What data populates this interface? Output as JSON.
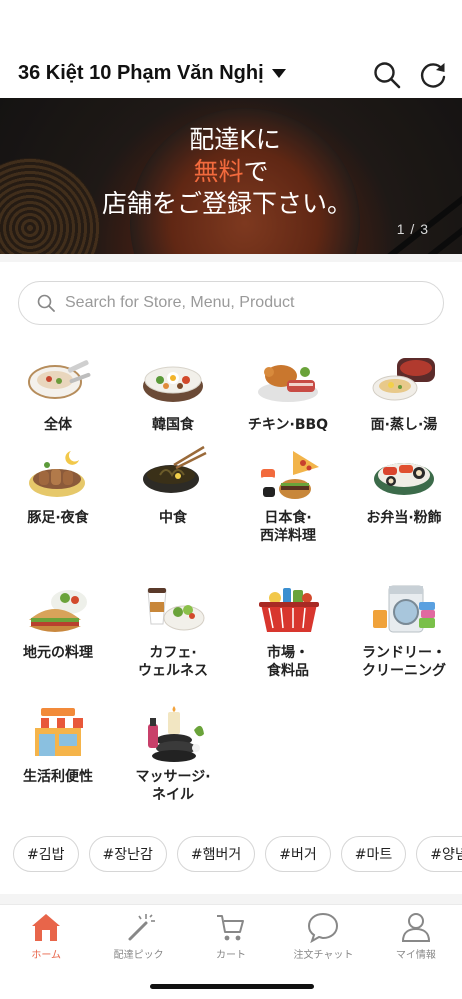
{
  "header": {
    "address": "36 Kiệt 10 Phạm Văn Nghị",
    "search_icon": "search-icon",
    "refresh_icon": "refresh-icon"
  },
  "banner": {
    "line1": "配達Kに",
    "line2_highlight": "無料",
    "line2_rest": "で",
    "line3": "店舗をご登録下さい。",
    "pager": "1 / 3",
    "highlight_color": "#f26a3d"
  },
  "search": {
    "placeholder": "Search for Store, Menu, Product"
  },
  "categories": [
    {
      "label": "全体",
      "icon": "all-food-icon"
    },
    {
      "label": "韓国食",
      "icon": "korean-bibimbap-icon"
    },
    {
      "label": "チキン·BBQ",
      "icon": "chicken-bbq-icon"
    },
    {
      "label": "面·蒸し·湯",
      "icon": "noodle-soup-icon"
    },
    {
      "label": "豚足·夜食",
      "icon": "pork-feet-icon"
    },
    {
      "label": "中食",
      "icon": "chinese-noodle-icon"
    },
    {
      "label": "日本食·\n西洋料理",
      "icon": "sushi-pizza-icon"
    },
    {
      "label": "お弁当·粉飾",
      "icon": "lunchbox-icon"
    },
    {
      "label": "地元の料理",
      "icon": "sandwich-icon"
    },
    {
      "label": "カフェ·\nウェルネス",
      "icon": "cafe-salad-icon"
    },
    {
      "label": "市場・\n食料品",
      "icon": "grocery-basket-icon"
    },
    {
      "label": "ランドリー・\nクリーニング",
      "icon": "washing-machine-icon"
    },
    {
      "label": "生活利便性",
      "icon": "store-icon"
    },
    {
      "label": "マッサージ·\nネイル",
      "icon": "spa-icon"
    }
  ],
  "tags": [
    "#김밥",
    "#장난감",
    "#햄버거",
    "#버거",
    "#마트",
    "#양념치"
  ],
  "tabbar": [
    {
      "label": "ホーム",
      "icon": "home-icon",
      "active": true
    },
    {
      "label": "配達ピック",
      "icon": "magic-wand-icon",
      "active": false
    },
    {
      "label": "カート",
      "icon": "cart-icon",
      "active": false
    },
    {
      "label": "注文チャット",
      "icon": "chat-icon",
      "active": false
    },
    {
      "label": "マイ情報",
      "icon": "user-icon",
      "active": false
    }
  ],
  "colors": {
    "accent": "#e8654a",
    "inactive": "#888888"
  }
}
